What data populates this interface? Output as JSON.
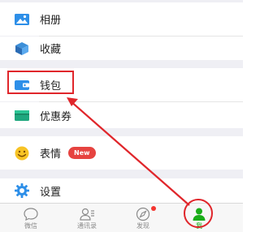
{
  "menu": {
    "album": {
      "label": "相册",
      "icon": "album-icon"
    },
    "favorites": {
      "label": "收藏",
      "icon": "favorites-cube-icon"
    },
    "wallet": {
      "label": "钱包",
      "icon": "wallet-icon"
    },
    "coupons": {
      "label": "优惠券",
      "icon": "coupon-card-icon"
    },
    "stickers": {
      "label": "表情",
      "icon": "smiley-icon",
      "badge": "New"
    },
    "settings": {
      "label": "设置",
      "icon": "gear-icon"
    }
  },
  "tabbar": {
    "chats": {
      "label": "微信",
      "icon": "chat-bubble-icon"
    },
    "contacts": {
      "label": "通讯录",
      "icon": "contacts-icon"
    },
    "discover": {
      "label": "发现",
      "icon": "compass-icon"
    },
    "me": {
      "label": "我",
      "icon": "person-icon",
      "active": true
    }
  },
  "colors": {
    "accent_green": "#1aad19",
    "highlight_red": "#e0262b",
    "badge_red": "#e64340",
    "icon_blue": "#2e8fe8"
  }
}
